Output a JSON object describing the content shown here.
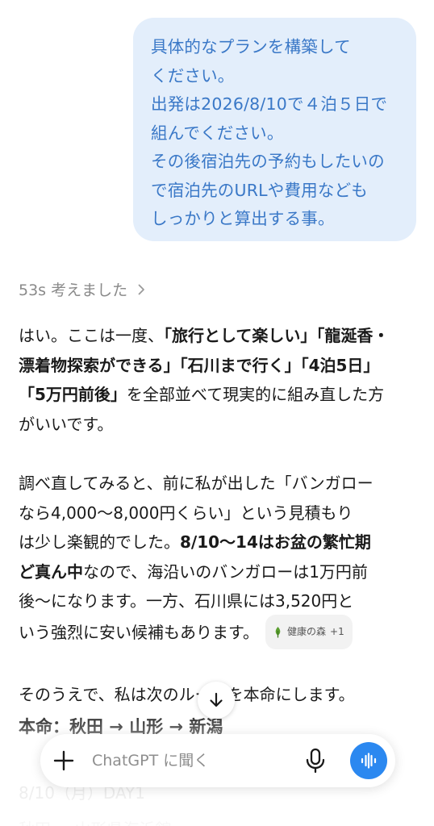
{
  "user_message": {
    "lines": [
      "具体的なプランを構築して",
      "ください。",
      "出発は2026/8/10で４泊５日で",
      "組んでください。",
      "その後宿泊先の予約もしたいの",
      "で宿泊先のURLや費用なども",
      "しっかりと算出する事。"
    ]
  },
  "thought": {
    "label": "53s 考えました"
  },
  "answer": {
    "p1": {
      "l1a": "はい。ここは一度、",
      "l1b": "「旅行として楽しい」「龍涎香・",
      "l2a": "漂着物探索ができる」「石川まで行く」「4泊5日」",
      "l3a": "「5万円前後」",
      "l3b": "を全部並べて現実的に組み直した方",
      "l4": "がいいです。"
    },
    "p2": {
      "l1": "調べ直してみると、前に私が出した「バンガロー",
      "l2": "なら4,000〜8,000円くらい」という見積もり",
      "l3a": "は少し楽観的でした。",
      "l3b": "8/10〜14はお盆の繁忙期",
      "l4a": "ど真ん中",
      "l4b": "なので、海沿いのバンガローは1万円前",
      "l5": "後〜になります。一方、石川県には3,520円と",
      "l6": "いう強烈に安い候補もあります。"
    },
    "source_chip": {
      "label": "健康の森",
      "count": "+1"
    },
    "p3": "そのうえで、私は次のルートを本命にします。",
    "heading": "本命：秋田 → 山形 → 新潟",
    "faded_line": "8/10（月）DAY1",
    "faded_line2": "秋田 → 山形県海浜館"
  },
  "composer": {
    "placeholder": "ChatGPT に聞く"
  },
  "colors": {
    "user_bubble_bg": "#e3eefb",
    "user_text": "#3a78c7",
    "voice_button": "#2b88f0",
    "chip_leaf": "#5a9e2f"
  },
  "icons": [
    "chevron-right-icon",
    "leaf-icon",
    "arrow-down-icon",
    "plus-icon",
    "mic-icon",
    "voice-wave-icon"
  ]
}
